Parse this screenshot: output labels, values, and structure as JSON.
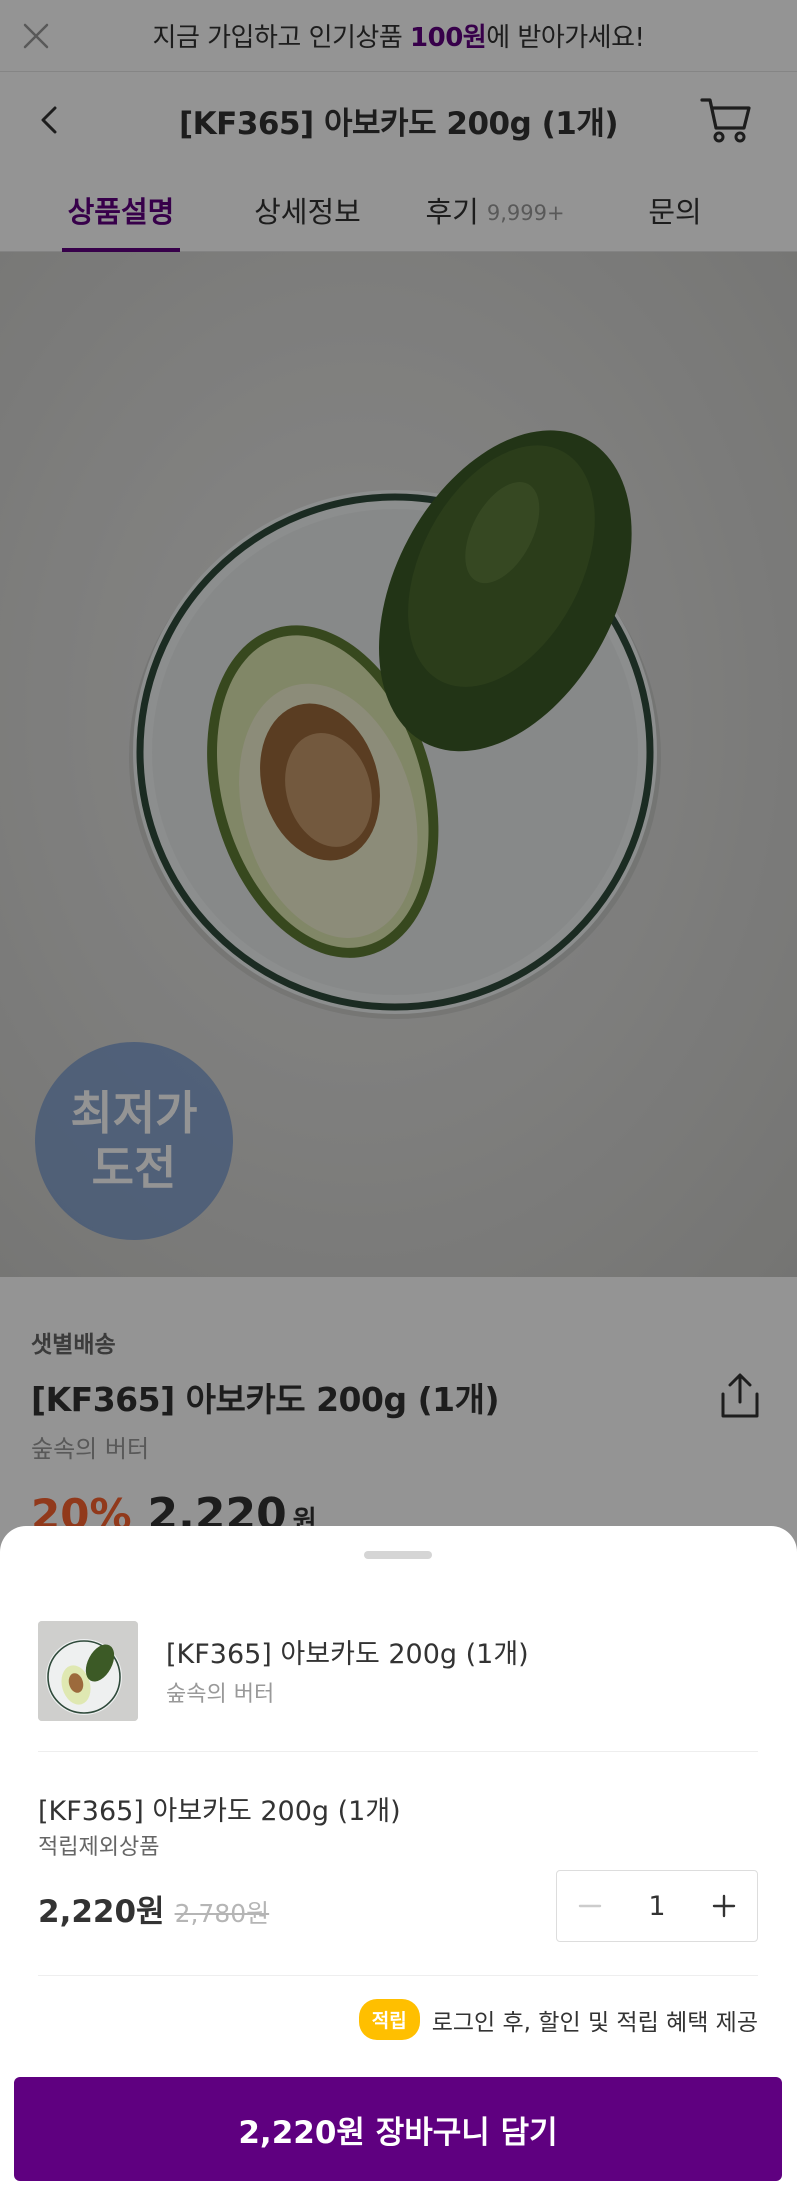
{
  "banner": {
    "text_before": "지금 가입하고 인기상품 ",
    "highlight": "100원",
    "text_after": "에 받아가세요!"
  },
  "header": {
    "title": "[KF365] 아보카도 200g (1개)"
  },
  "tabs": [
    {
      "label": "상품설명",
      "active": true
    },
    {
      "label": "상세정보",
      "active": false
    },
    {
      "label": "후기",
      "count": "9,999+",
      "active": false
    },
    {
      "label": "문의",
      "active": false
    }
  ],
  "hero": {
    "badge_line1": "최저가",
    "badge_line2": "도전"
  },
  "product": {
    "delivery": "샛별배송",
    "title": "[KF365] 아보카도 200g (1개)",
    "subtitle": "숲속의 버터",
    "discount": "20%",
    "price": "2,220",
    "unit": "원"
  },
  "sheet": {
    "item_name": "[KF365] 아보카도 200g (1개)",
    "item_brand": "숲속의 버터",
    "option_name": "[KF365] 아보카도 200g (1개)",
    "option_note": "적립제외상품",
    "sale_price": "2,220원",
    "original_price": "2,780원",
    "quantity": "1",
    "benefit_badge": "적립",
    "benefit_text": "로그인 후, 할인 및 적립 혜택 제공",
    "cta_label": "2,220원 장바구니 담기"
  },
  "colors": {
    "brand_purple": "#5f0080",
    "discount_orange": "#fa622f",
    "benefit_yellow": "#ffbf00"
  },
  "icons": [
    "close-icon",
    "back-chevron-icon",
    "cart-icon",
    "share-icon",
    "minus-icon",
    "plus-icon"
  ]
}
